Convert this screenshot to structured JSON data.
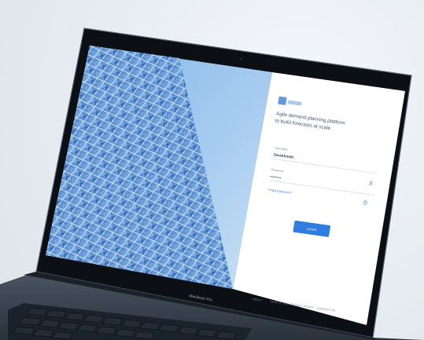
{
  "device": {
    "model_label": "MacBook Pro"
  },
  "login": {
    "tagline_line1": "Agile demand planning platform",
    "tagline_line2": "to build forecasts at scale",
    "username_label": "Username",
    "username_value": "SarahSmith",
    "password_label": "Password",
    "password_value": "••••••••••",
    "forgot_label": "Forgot password?",
    "login_button": "LOGIN",
    "login_button_color": "#2f7de1"
  },
  "footer": {
    "links": [
      "ABOUT",
      "TERM OF USE",
      "PRIVACY POLICY",
      "CONTACT US"
    ]
  },
  "icons": {
    "user": "user-icon",
    "lock": "lock-icon"
  }
}
